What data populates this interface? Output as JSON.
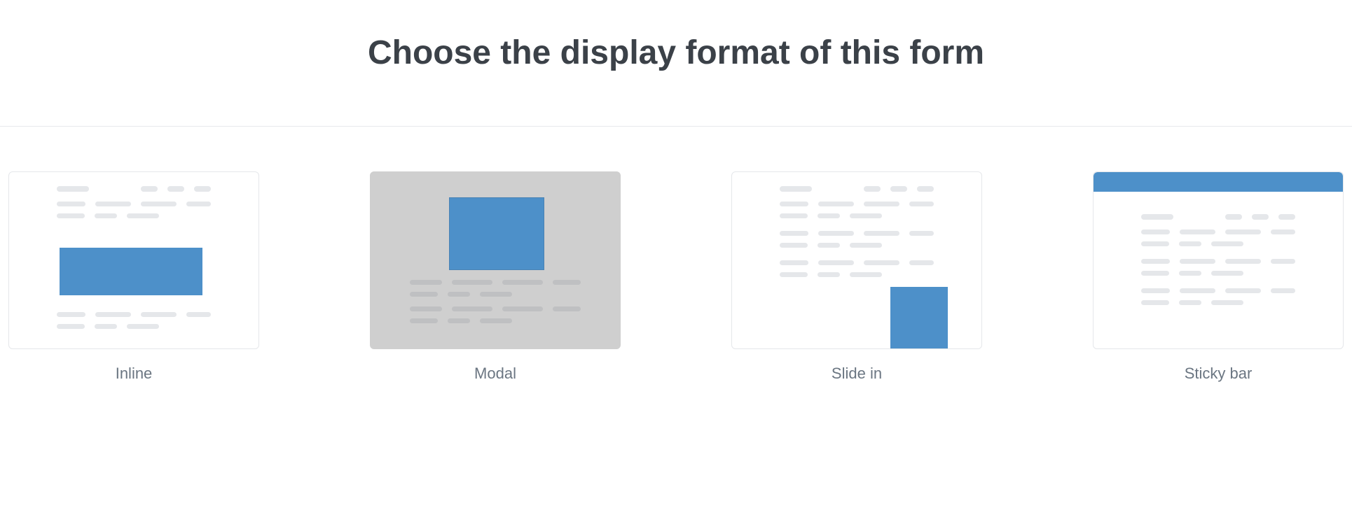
{
  "header": {
    "title": "Choose the display format of this form"
  },
  "options": [
    {
      "id": "inline",
      "label": "Inline"
    },
    {
      "id": "modal",
      "label": "Modal"
    },
    {
      "id": "slidein",
      "label": "Slide in"
    },
    {
      "id": "stickybar",
      "label": "Sticky bar"
    }
  ],
  "colors": {
    "accent": "#4d90c9",
    "textDim": "#6b7682",
    "border": "#e5e7ea",
    "modalBg": "#cfcfcf"
  }
}
